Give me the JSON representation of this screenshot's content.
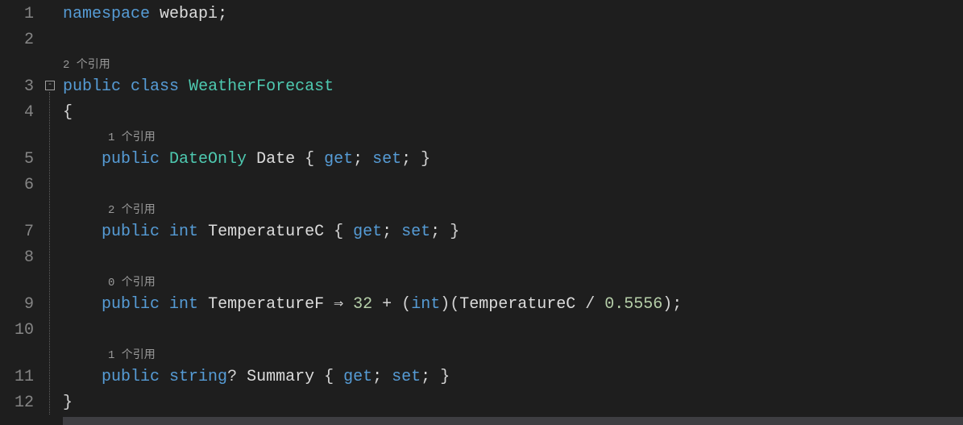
{
  "code": {
    "line1": {
      "kw_namespace": "namespace",
      "ns": "webapi",
      "semi": ";"
    },
    "codelens_class": "2 个引用",
    "line3": {
      "kw_public": "public",
      "kw_class": "class",
      "name": "WeatherForecast"
    },
    "line4": {
      "brace": "{"
    },
    "codelens_date": "1 个引用",
    "line5": {
      "kw_public": "public",
      "type": "DateOnly",
      "name": "Date",
      "open": " { ",
      "get": "get",
      "semi1": "; ",
      "set": "set",
      "semi2": "; ",
      "close": "}"
    },
    "codelens_tempC": "2 个引用",
    "line7": {
      "kw_public": "public",
      "type": "int",
      "name": "TemperatureC",
      "open": " { ",
      "get": "get",
      "semi1": "; ",
      "set": "set",
      "semi2": "; ",
      "close": "}"
    },
    "codelens_tempF": "0 个引用",
    "line9": {
      "kw_public": "public",
      "type": "int",
      "name": "TemperatureF",
      "arrow": " ⇒ ",
      "n32": "32",
      "plus": " + (",
      "cast": "int",
      "par": ")(",
      "ref": "TemperatureC",
      "div": " / ",
      "n05556": "0.5556",
      "end": ");"
    },
    "codelens_summary": "1 个引用",
    "line11": {
      "kw_public": "public",
      "type": "string",
      "q": "?",
      "name": "Summary",
      "open": " { ",
      "get": "get",
      "semi1": "; ",
      "set": "set",
      "semi2": "; ",
      "close": "}"
    },
    "line12": {
      "brace": "}"
    }
  },
  "linenums": {
    "l1": "1",
    "l2": "2",
    "l3": "3",
    "l4": "4",
    "l5": "5",
    "l6": "6",
    "l7": "7",
    "l8": "8",
    "l9": "9",
    "l10": "10",
    "l11": "11",
    "l12": "12"
  }
}
